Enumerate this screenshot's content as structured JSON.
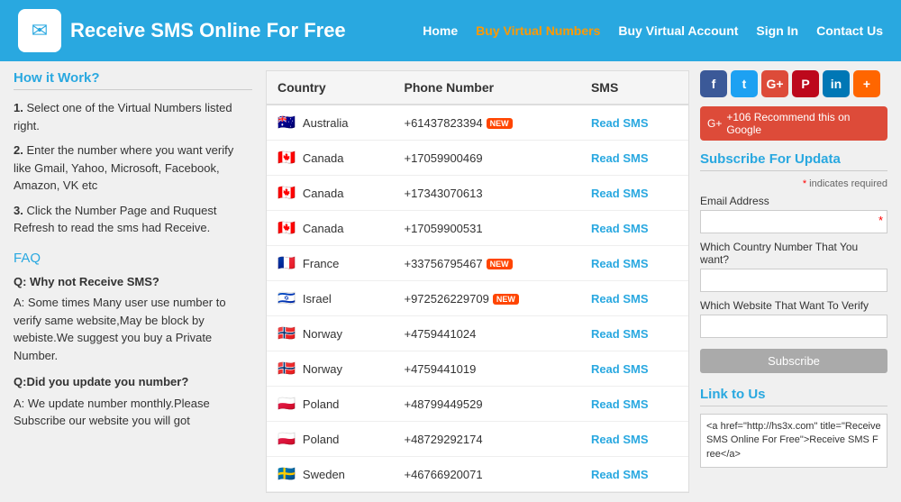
{
  "header": {
    "title": "Receive SMS Online For Free",
    "logo_icon": "✉",
    "nav": [
      {
        "label": "Home",
        "url": "#",
        "class": ""
      },
      {
        "label": "Buy Virtual Numbers",
        "url": "#",
        "class": "orange"
      },
      {
        "label": "Buy Virtual Account",
        "url": "#",
        "class": ""
      },
      {
        "label": "Sign In",
        "url": "#",
        "class": ""
      },
      {
        "label": "Contact Us",
        "url": "#",
        "class": ""
      }
    ]
  },
  "sidebar": {
    "how_title": "How it Work?",
    "steps": [
      {
        "number": "1.",
        "text": "Select one of the Virtual Numbers listed right."
      },
      {
        "number": "2.",
        "text": "Enter the number where you want verify like Gmail, Yahoo, Microsoft, Facebook, Amazon, VK etc"
      },
      {
        "number": "3.",
        "text": "Click the Number Page and Ruquest Refresh to read the sms had Receive."
      }
    ],
    "faq_title": "FAQ",
    "faq_items": [
      {
        "q": "Q: Why not Receive SMS?",
        "a": "A: Some times Many user use number to verify same website,May be block by webiste.We suggest you buy a Private Number."
      },
      {
        "q": "Q:Did you update you number?",
        "a": "A: We update number monthly.Please Subscribe our website you will got"
      }
    ]
  },
  "table": {
    "headers": [
      "Country",
      "Phone Number",
      "SMS"
    ],
    "rows": [
      {
        "flag": "🇦🇺",
        "country": "Australia",
        "phone": "+61437823394",
        "is_new": true,
        "sms_label": "Read SMS"
      },
      {
        "flag": "🇨🇦",
        "country": "Canada",
        "phone": "+17059900469",
        "is_new": false,
        "sms_label": "Read SMS"
      },
      {
        "flag": "🇨🇦",
        "country": "Canada",
        "phone": "+17343070613",
        "is_new": false,
        "sms_label": "Read SMS"
      },
      {
        "flag": "🇨🇦",
        "country": "Canada",
        "phone": "+17059900531",
        "is_new": false,
        "sms_label": "Read SMS"
      },
      {
        "flag": "🇫🇷",
        "country": "France",
        "phone": "+33756795467",
        "is_new": true,
        "sms_label": "Read SMS"
      },
      {
        "flag": "🇮🇱",
        "country": "Israel",
        "phone": "+972526229709",
        "is_new": true,
        "sms_label": "Read SMS"
      },
      {
        "flag": "🇳🇴",
        "country": "Norway",
        "phone": "+4759441024",
        "is_new": false,
        "sms_label": "Read SMS"
      },
      {
        "flag": "🇳🇴",
        "country": "Norway",
        "phone": "+4759441019",
        "is_new": false,
        "sms_label": "Read SMS"
      },
      {
        "flag": "🇵🇱",
        "country": "Poland",
        "phone": "+48799449529",
        "is_new": false,
        "sms_label": "Read SMS"
      },
      {
        "flag": "🇵🇱",
        "country": "Poland",
        "phone": "+48729292174",
        "is_new": false,
        "sms_label": "Read SMS"
      },
      {
        "flag": "🇸🇪",
        "country": "Sweden",
        "phone": "+46766920071",
        "is_new": false,
        "sms_label": "Read SMS"
      }
    ]
  },
  "right_panel": {
    "social_buttons": [
      {
        "label": "f",
        "class": "fb",
        "name": "facebook"
      },
      {
        "label": "t",
        "class": "tw",
        "name": "twitter"
      },
      {
        "label": "G+",
        "class": "gp",
        "name": "google-plus"
      },
      {
        "label": "P",
        "class": "pi",
        "name": "pinterest"
      },
      {
        "label": "in",
        "class": "li",
        "name": "linkedin"
      },
      {
        "label": "+",
        "class": "rss",
        "name": "rss"
      }
    ],
    "google_bar": "+106  Recommend this on Google",
    "subscribe_title": "Subscribe For Updata",
    "required_note": "* indicates required",
    "form": {
      "email_label": "Email Address",
      "email_placeholder": "",
      "country_label": "Which Country Number That You want?",
      "country_placeholder": "",
      "website_label": "Which Website That Want To Verify",
      "website_placeholder": "",
      "submit_label": "Subscribe"
    },
    "link_title": "Link to Us",
    "link_code": "<a href=\"http://hs3x.com\" title=\"Receive SMS Online For Free\">Receive SMS Free</a>"
  }
}
